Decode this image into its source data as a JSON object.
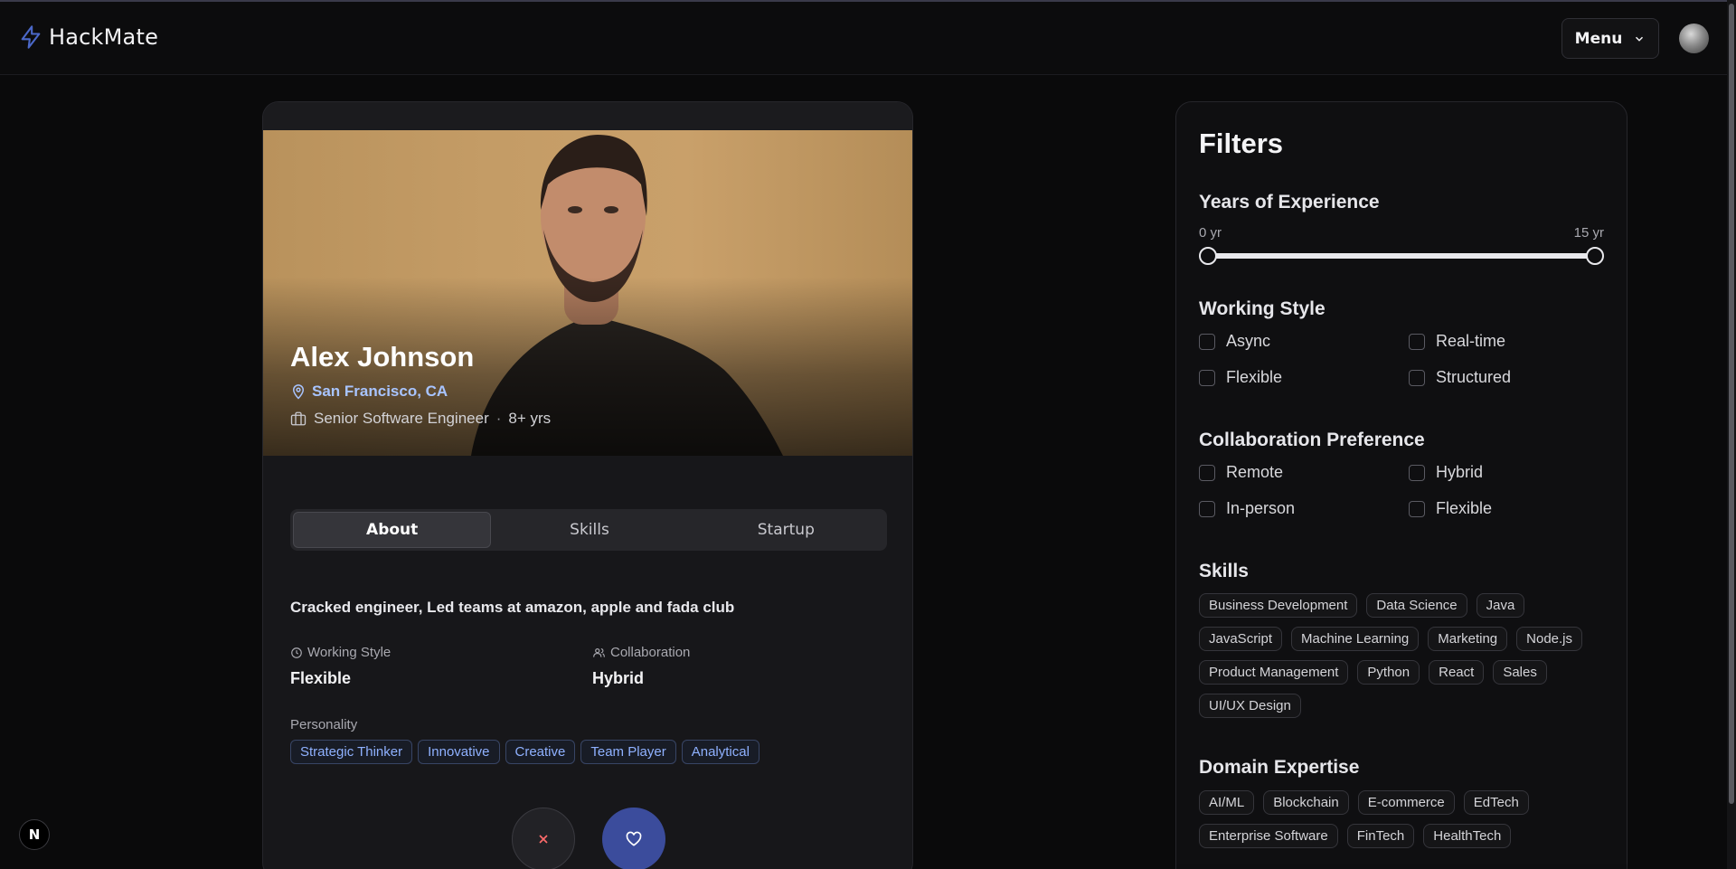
{
  "app": {
    "name": "HackMate",
    "menu_label": "Menu",
    "dev_badge": "N"
  },
  "profile": {
    "name": "Alex Johnson",
    "location": "San Francisco, CA",
    "role": "Senior Software Engineer",
    "experience": "8+ yrs",
    "tabs": [
      {
        "label": "About",
        "active": true
      },
      {
        "label": "Skills",
        "active": false
      },
      {
        "label": "Startup",
        "active": false
      }
    ],
    "about": "Cracked engineer, Led teams at amazon, apple and fada club",
    "working_style_label": "Working Style",
    "working_style_value": "Flexible",
    "collaboration_label": "Collaboration",
    "collaboration_value": "Hybrid",
    "personality_label": "Personality",
    "personality": [
      "Strategic Thinker",
      "Innovative",
      "Creative",
      "Team Player",
      "Analytical"
    ]
  },
  "filters": {
    "title": "Filters",
    "experience": {
      "label": "Years of Experience",
      "min_label": "0 yr",
      "max_label": "15 yr",
      "min": 0,
      "max": 15
    },
    "working_style": {
      "label": "Working Style",
      "options": [
        "Async",
        "Real-time",
        "Flexible",
        "Structured"
      ]
    },
    "collaboration": {
      "label": "Collaboration Preference",
      "options": [
        "Remote",
        "Hybrid",
        "In-person",
        "Flexible"
      ]
    },
    "skills": {
      "label": "Skills",
      "options": [
        "Business Development",
        "Data Science",
        "Java",
        "JavaScript",
        "Machine Learning",
        "Marketing",
        "Node.js",
        "Product Management",
        "Python",
        "React",
        "Sales",
        "UI/UX Design"
      ]
    },
    "domain": {
      "label": "Domain Expertise",
      "options": [
        "AI/ML",
        "Blockchain",
        "E-commerce",
        "EdTech",
        "Enterprise Software",
        "FinTech",
        "HealthTech"
      ]
    }
  },
  "colors": {
    "accent": "#3b4c9c",
    "link": "#a8c4ff",
    "tag_text": "#8fb1ff",
    "background": "#0a0a0b"
  }
}
